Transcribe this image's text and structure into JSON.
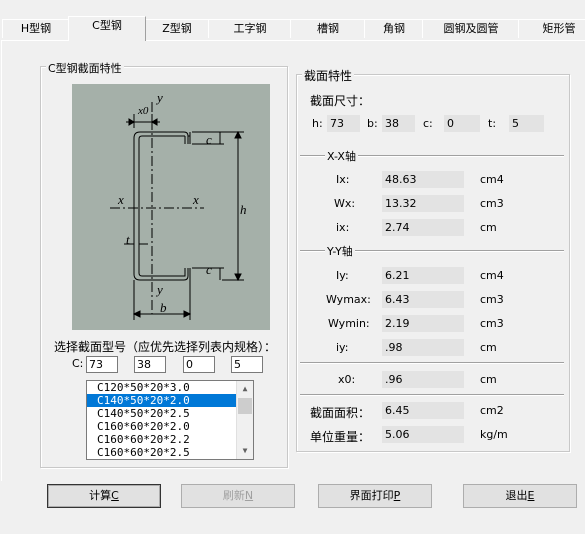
{
  "tabs": [
    {
      "label": "H型钢",
      "active": false
    },
    {
      "label": "C型钢",
      "active": true
    },
    {
      "label": "Z型钢",
      "active": false
    },
    {
      "label": "工字钢",
      "active": false
    },
    {
      "label": "槽钢",
      "active": false
    },
    {
      "label": "角钢",
      "active": false
    },
    {
      "label": "圆钢及圆管",
      "active": false
    },
    {
      "label": "矩形管",
      "active": false
    }
  ],
  "left_group": {
    "title": "C型钢截面特性",
    "diagram_labels": {
      "y_top": "y",
      "x0": "x0",
      "c_top": "c",
      "x_left": "x",
      "x_right": "x",
      "h": "h",
      "t": "t",
      "c_bottom": "c",
      "y_bottom": "y",
      "b": "b"
    },
    "select_prompt": "选择截面型号（应优先选择列表内规格）：",
    "dims_label": "C:",
    "dims": {
      "h": "73",
      "b": "38",
      "c": "0",
      "t": "5"
    },
    "list_items": [
      "C120*50*20*3.0",
      "C140*50*20*2.0",
      "C140*50*20*2.5",
      "C160*60*20*2.0",
      "C160*60*20*2.2",
      "C160*60*20*2.5"
    ],
    "selected_index": 1
  },
  "right_group": {
    "title": "截面特性",
    "size_title": "截面尺寸：",
    "size": {
      "h_label": "h:",
      "h": "73",
      "b_label": "b:",
      "b": "38",
      "c_label": "c:",
      "c": "0",
      "t_label": "t:",
      "t": "5"
    },
    "xx_title": "X-X轴",
    "ix_big": {
      "label": "Ix:",
      "value": "48.63",
      "unit": "cm4"
    },
    "wx": {
      "label": "Wx:",
      "value": "13.32",
      "unit": "cm3"
    },
    "ix_small": {
      "label": "ix:",
      "value": "2.74",
      "unit": "cm"
    },
    "yy_title": "Y-Y轴",
    "iy_big": {
      "label": "Iy:",
      "value": "6.21",
      "unit": "cm4"
    },
    "wymax": {
      "label": "Wymax:",
      "value": "6.43",
      "unit": "cm3"
    },
    "wymin": {
      "label": "Wymin:",
      "value": "2.19",
      "unit": "cm3"
    },
    "iy_small": {
      "label": "iy:",
      "value": ".98",
      "unit": "cm"
    },
    "x0": {
      "label": "x0:",
      "value": ".96",
      "unit": "cm"
    },
    "area": {
      "label": "截面面积：",
      "value": "6.45",
      "unit": "cm2"
    },
    "weight": {
      "label": "单位重量：",
      "value": "5.06",
      "unit": "kg/m"
    }
  },
  "buttons": {
    "calc": {
      "text": "计算",
      "key": "C"
    },
    "refresh": {
      "text": "刷新",
      "key": "N"
    },
    "print": {
      "text": "界面打印",
      "key": "P"
    },
    "exit": {
      "text": "退出",
      "key": "E"
    }
  }
}
